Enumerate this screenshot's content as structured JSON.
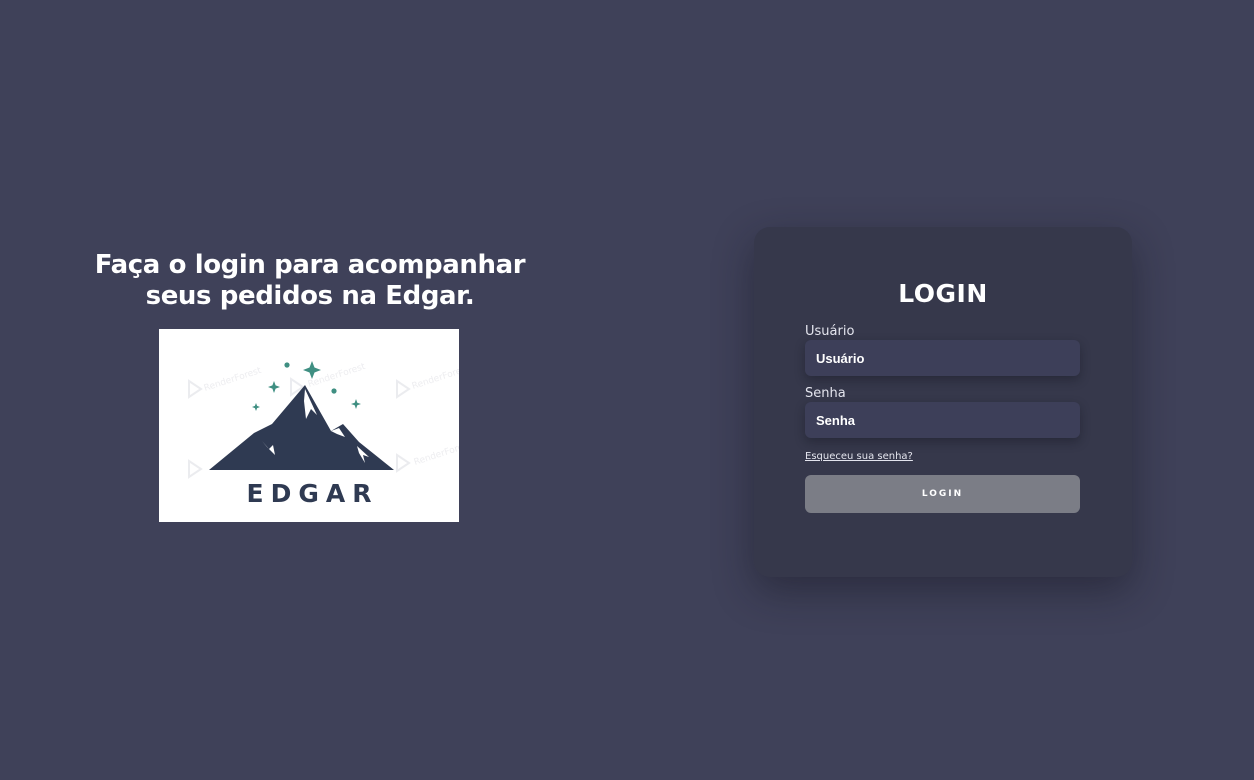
{
  "hero": {
    "title_line1": "Faça o login para acompanhar",
    "title_line2": "seus pedidos na Edgar.",
    "logo": {
      "icon": "mountain-logo-icon",
      "word": "EDGAR",
      "watermark": "RenderForest",
      "colors": {
        "mountain": "#2f3a52",
        "stars": "#3f8f82"
      }
    }
  },
  "login": {
    "title": "LOGIN",
    "username": {
      "label": "Usuário",
      "value": "Usuário",
      "placeholder": "Usuário"
    },
    "password": {
      "label": "Senha",
      "value": "Senha",
      "placeholder": "Senha"
    },
    "forgot_label": "Esqueceu sua senha?",
    "submit_label": "LOGIN"
  },
  "colors": {
    "background": "#3f4159",
    "card": "#36384b",
    "input": "#3d3f59",
    "button": "#7b7d86"
  }
}
